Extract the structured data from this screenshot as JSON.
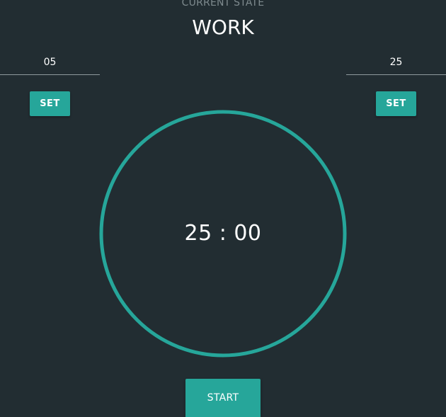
{
  "state": {
    "label": "CURRENT STATE",
    "value": "WORK"
  },
  "break_duration": {
    "value": "05",
    "set_label": "SET"
  },
  "work_duration": {
    "value": "25",
    "set_label": "SET"
  },
  "timer": {
    "display": "25 : 00",
    "ring_color": "#26a69a"
  },
  "controls": {
    "start_label": "START"
  },
  "colors": {
    "background": "#222d32",
    "accent": "#26a69a"
  }
}
